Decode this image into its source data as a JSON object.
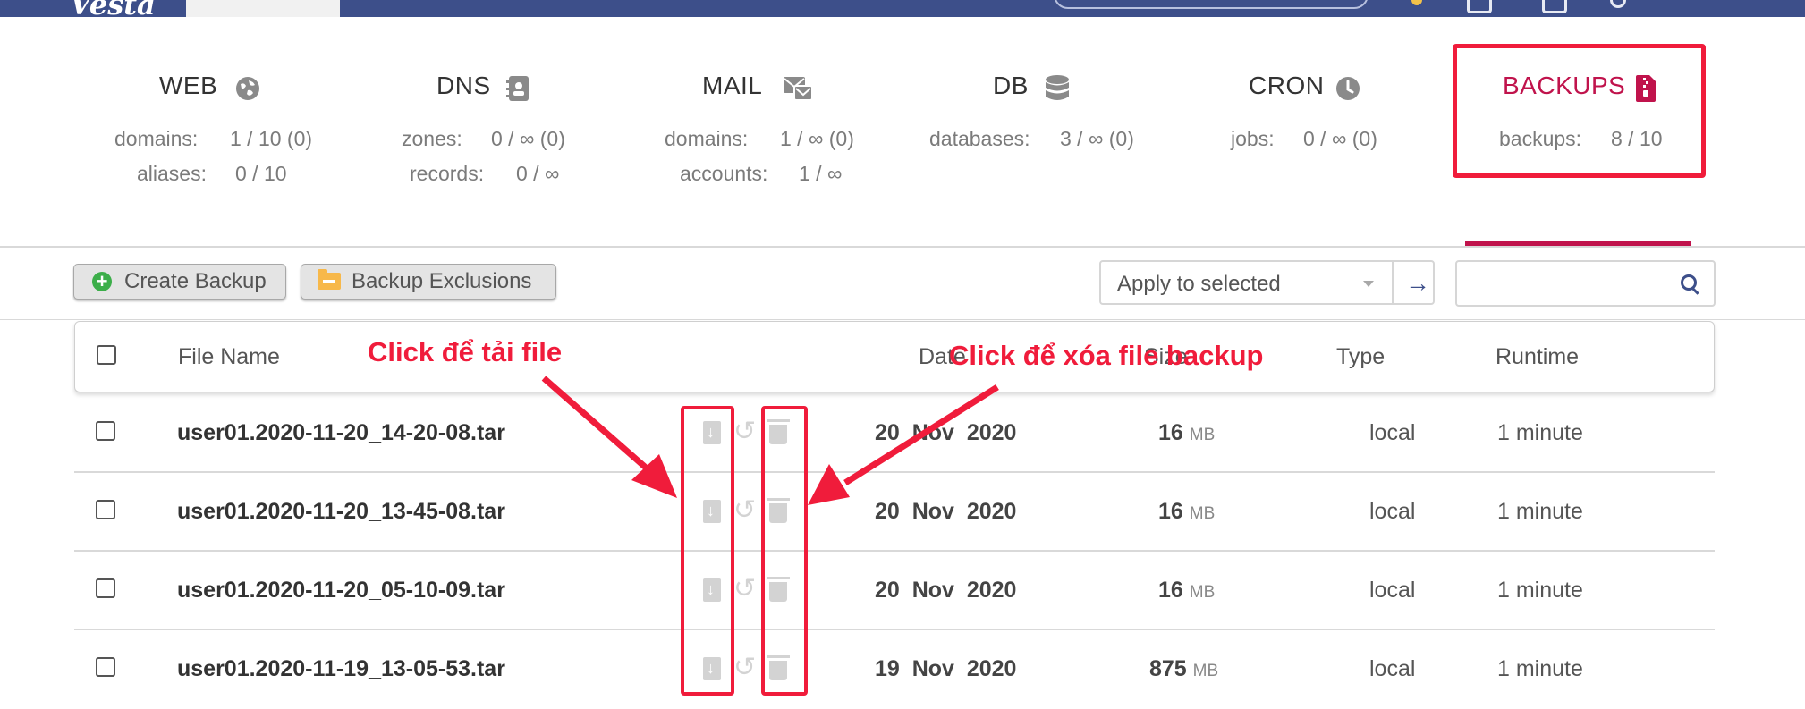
{
  "top_bar": {
    "logo": "Vesta"
  },
  "stats": [
    {
      "title": "WEB",
      "icon": "globe-icon",
      "lines": [
        {
          "label": "domains:",
          "value": "1 / 10 (0)"
        },
        {
          "label": "aliases:",
          "value": "0 / 10"
        }
      ]
    },
    {
      "title": "DNS",
      "icon": "address-book-icon",
      "lines": [
        {
          "label": "zones:",
          "value": "0 / ∞ (0)"
        },
        {
          "label": "records:",
          "value": "0 / ∞"
        }
      ]
    },
    {
      "title": "MAIL",
      "icon": "mail-icon",
      "lines": [
        {
          "label": "domains:",
          "value": "1 / ∞ (0)"
        },
        {
          "label": "accounts:",
          "value": "1 / ∞"
        }
      ]
    },
    {
      "title": "DB",
      "icon": "database-icon",
      "lines": [
        {
          "label": "databases:",
          "value": "3 / ∞ (0)"
        }
      ]
    },
    {
      "title": "CRON",
      "icon": "clock-icon",
      "lines": [
        {
          "label": "jobs:",
          "value": "0 / ∞ (0)"
        }
      ]
    },
    {
      "title": "BACKUPS",
      "icon": "archive-file-icon",
      "selected": true,
      "lines": [
        {
          "label": "backups:",
          "value": "8 / 10"
        }
      ]
    }
  ],
  "toolbar": {
    "create_backup": "Create Backup",
    "backup_exclusions": "Backup Exclusions",
    "apply_select": "Apply to selected",
    "search_placeholder": ""
  },
  "table": {
    "headers": {
      "file_name": "File Name",
      "date": "Date",
      "size": "Size",
      "type": "Type",
      "runtime": "Runtime"
    },
    "rows": [
      {
        "file": "user01.2020-11-20_14-20-08.tar",
        "date": "20  Nov  2020",
        "size": "16",
        "unit": "MB",
        "type": "local",
        "runtime": "1 minute"
      },
      {
        "file": "user01.2020-11-20_13-45-08.tar",
        "date": "20  Nov  2020",
        "size": "16",
        "unit": "MB",
        "type": "local",
        "runtime": "1 minute"
      },
      {
        "file": "user01.2020-11-20_05-10-09.tar",
        "date": "20  Nov  2020",
        "size": "16",
        "unit": "MB",
        "type": "local",
        "runtime": "1 minute"
      },
      {
        "file": "user01.2020-11-19_13-05-53.tar",
        "date": "19  Nov  2020",
        "size": "875",
        "unit": "MB",
        "type": "local",
        "runtime": "1 minute"
      }
    ]
  },
  "annotations": {
    "download_hint": "Click để tải file",
    "delete_hint": "Click để xóa file backup",
    "highlight_color": "#f01c3b"
  },
  "colors": {
    "accent": "#c0134c",
    "topbar": "#3d4f8a"
  }
}
